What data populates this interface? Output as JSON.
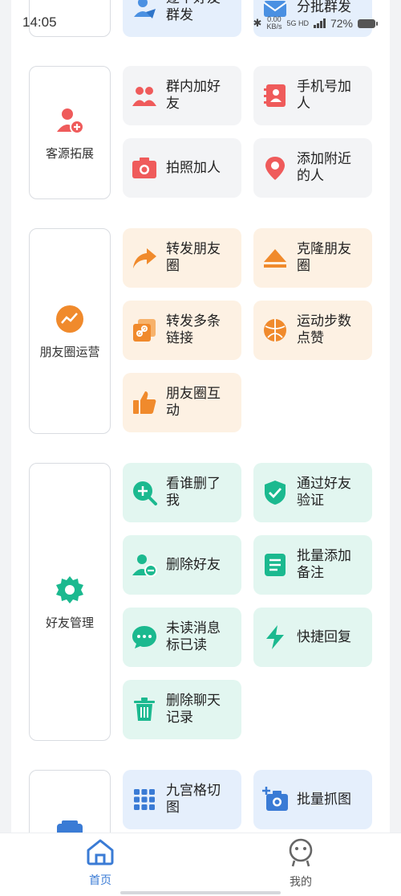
{
  "status_bar": {
    "time": "14:05",
    "network_speed": "0.00",
    "network_unit": "KB/s",
    "signal_label": "5G HD",
    "battery": "72%"
  },
  "top_partial": {
    "left_label": "逐个好友群发",
    "right_label": "分批群发"
  },
  "categories": [
    {
      "label": "客源拓展",
      "icon": "add-user-icon"
    },
    {
      "label": "朋友圈运营",
      "icon": "trend-icon"
    },
    {
      "label": "好友管理",
      "icon": "gear-icon"
    }
  ],
  "tiles": {
    "group_add": "群内加好友",
    "phone_add": "手机号加人",
    "photo_add": "拍照加人",
    "nearby_add": "添加附近的人",
    "forward_moments": "转发朋友圈",
    "clone_moments": "克隆朋友圈",
    "forward_links": "转发多条链接",
    "step_like": "运动步数点赞",
    "moments_interact": "朋友圈互动",
    "who_deleted": "看谁删了我",
    "pass_verify": "通过好友验证",
    "delete_friend": "删除好友",
    "batch_remark": "批量添加备注",
    "mark_read": "未读消息标已读",
    "quick_reply": "快捷回复",
    "delete_chat": "删除聊天记录",
    "grid_cut": "九宫格切图",
    "batch_capture": "批量抓图"
  },
  "nav": {
    "home": "首页",
    "mine": "我的"
  },
  "colors": {
    "accent": "#3a7bd5",
    "orange": "#f08a2c",
    "teal": "#1bb98f",
    "red": "#ee5a5a"
  }
}
